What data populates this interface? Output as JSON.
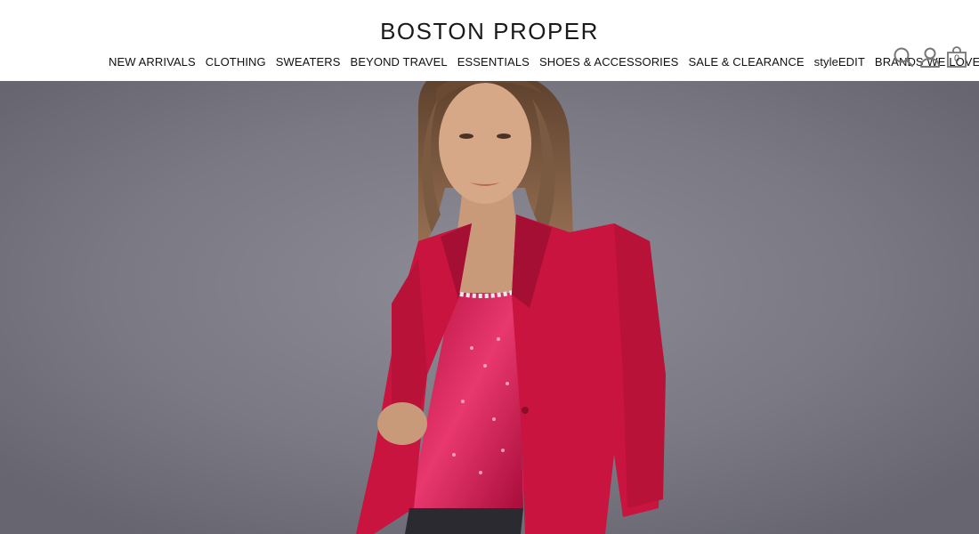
{
  "brand": {
    "name": "BOSTON PROPER"
  },
  "nav": {
    "items": [
      "NEW ARRIVALS",
      "CLOTHING",
      "SWEATERS",
      "BEYOND TRAVEL",
      "ESSENTIALS",
      "SHOES & ACCESSORIES",
      "SALE & CLEARANCE",
      "styleEDIT",
      "BRANDS WE LOVE"
    ]
  },
  "header_icons": {
    "search": "search-icon",
    "account": "user-icon",
    "bag": "shopping-bag-icon"
  },
  "cart": {
    "count": "0"
  },
  "colors": {
    "blazer": "#c8143f",
    "backdrop": "#7b7a84",
    "top_sequin": "#e21a5a"
  }
}
